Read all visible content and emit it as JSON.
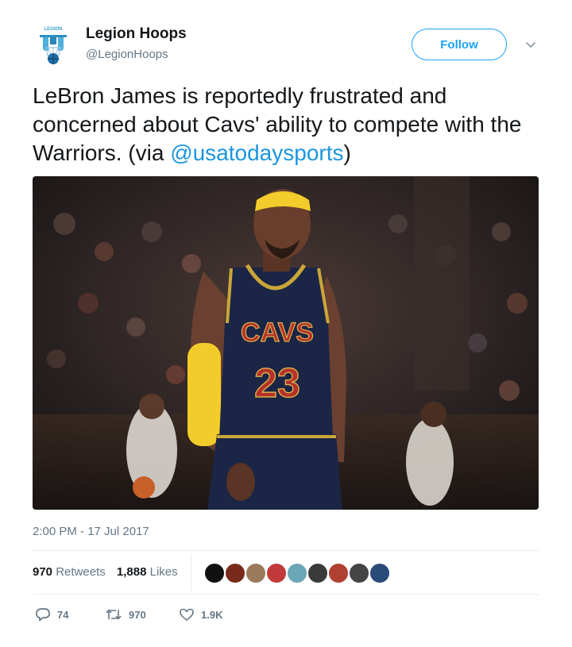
{
  "account": {
    "display_name": "Legion Hoops",
    "handle": "@LegionHoops",
    "logo_text": "LEGION"
  },
  "follow_label": "Follow",
  "tweet": {
    "text_before_mention": "LeBron James is reportedly frustrated and concerned about Cavs' ability to compete with the Warriors. (via ",
    "mention": "@usatodaysports",
    "text_after_mention": ")"
  },
  "media": {
    "jersey_team": "CAVS",
    "jersey_number": "23"
  },
  "timestamp": "2:00 PM - 17 Jul 2017",
  "stats": {
    "retweets_count": "970",
    "retweets_label": "Retweets",
    "likes_count": "1,888",
    "likes_label": "Likes"
  },
  "likers_avatar_colors": [
    "#111111",
    "#7a2a1a",
    "#9a7a5a",
    "#c23a3a",
    "#6aa6b5",
    "#3a3a3a",
    "#b04030",
    "#444444",
    "#2a4a7a"
  ],
  "actions": {
    "reply_count": "74",
    "retweet_count": "970",
    "like_count": "1.9K"
  },
  "colors": {
    "accent": "#1da1f2",
    "mention": "#1b95e0",
    "muted": "#657786",
    "text": "#14171a"
  }
}
